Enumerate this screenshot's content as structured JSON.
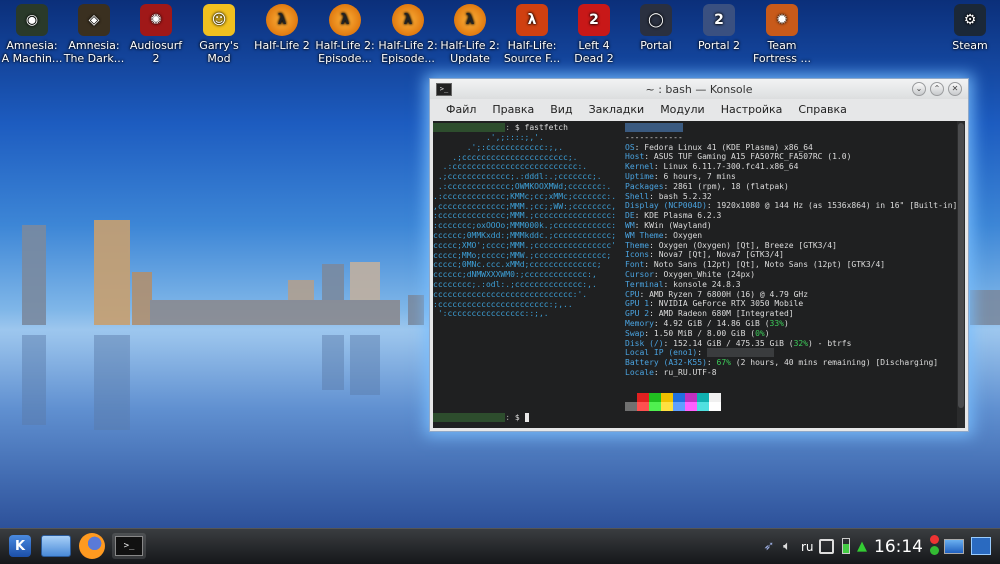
{
  "desktop": {
    "icons": [
      {
        "id": "amnesia-machine",
        "line1": "Amnesia:",
        "line2": "A Machin...",
        "glyph": "◉",
        "color": "#2a3a2a"
      },
      {
        "id": "amnesia-dark",
        "line1": "Amnesia:",
        "line2": "The Dark...",
        "glyph": "◈",
        "color": "#3a3020"
      },
      {
        "id": "audiosurf",
        "line1": "Audiosurf",
        "line2": "2",
        "glyph": "✺",
        "color": "#a01818"
      },
      {
        "id": "garrys-mod",
        "line1": "Garry's",
        "line2": "Mod",
        "glyph": "☺",
        "color": "#f0c020"
      },
      {
        "id": "half-life-2",
        "line1": "Half-Life 2",
        "line2": "",
        "glyph": "λ",
        "color": "hl2"
      },
      {
        "id": "hl2-ep1",
        "line1": "Half-Life 2:",
        "line2": "Episode...",
        "glyph": "λ",
        "color": "hl2"
      },
      {
        "id": "hl2-ep2",
        "line1": "Half-Life 2:",
        "line2": "Episode...",
        "glyph": "λ",
        "color": "hl2"
      },
      {
        "id": "hl2-update",
        "line1": "Half-Life 2:",
        "line2": "Update",
        "glyph": "λ",
        "color": "hl2"
      },
      {
        "id": "hl-source",
        "line1": "Half-Life:",
        "line2": "Source F...",
        "glyph": "λ",
        "color": "#d04010"
      },
      {
        "id": "l4d2",
        "line1": "Left 4",
        "line2": "Dead 2",
        "glyph": "2",
        "color": "#c81818"
      },
      {
        "id": "portal",
        "line1": "Portal",
        "line2": "",
        "glyph": "◯",
        "color": "#2a3040"
      },
      {
        "id": "portal-2",
        "line1": "Portal 2",
        "line2": "",
        "glyph": "2",
        "color": "#3a5080"
      },
      {
        "id": "tf2",
        "line1": "Team",
        "line2": "Fortress ...",
        "glyph": "✹",
        "color": "#c85a1a"
      },
      {
        "id": "steam",
        "line1": "Steam",
        "line2": "",
        "glyph": "⚙",
        "color": "#1b2838"
      }
    ]
  },
  "konsole": {
    "title": "~ : bash — Konsole",
    "menu": [
      "Файл",
      "Правка",
      "Вид",
      "Закладки",
      "Модули",
      "Настройка",
      "Справка"
    ],
    "command": "$ fastfetch",
    "logo": [
      "           .',;::::;,'.",
      "       .';:cccccccccccc:;,.",
      "    .;cccccccccccccccccccccc;.",
      "  .:cccccccccccccccccccccccccc:.",
      " .;ccccccccccccc;.:dddl:.;ccccccc;.",
      " .:ccccccccccccc;OWMKOOXMWd;ccccccc:.",
      ".:ccccccccccccc;KMMc;cc;xMMc;ccccccc:.",
      ",cccccccccccccc;MMM.;cc;;WW:;cccccccc,",
      ":cccccccccccccc;MMM.;cccccccccccccccc:",
      ":ccccccc;oxOOOo;MMM000k.;cccccccccccc:",
      "cccccc;0MMKxdd:;MMMkddc.;cccccccccccc;",
      "ccccc;XMO';cccc;MMM.;cccccccccccccccc'",
      "ccccc;MMo;ccccc;MMW.;ccccccccccccccc;",
      "ccccc;0MNc.ccc.xMMd;cccccccccccccc;",
      "cccccc;dNMWXXXWM0:;ccccccccccccc:,",
      "cccccccc;.:odl:.;cccccccccccccc:,.",
      "ccccccccccccccccccccccccccccc:'.",
      ":ccccccccccccccccccccccc:;,..",
      " ':cccccccccccccccc::;,."
    ],
    "info": [
      {
        "k": "",
        "v": "------------"
      },
      {
        "k": "OS",
        "v": "Fedora Linux 41 (KDE Plasma) x86_64"
      },
      {
        "k": "Host",
        "v": "ASUS TUF Gaming A15 FA507RC_FA507RC (1.0)"
      },
      {
        "k": "Kernel",
        "v": "Linux 6.11.7-300.fc41.x86_64"
      },
      {
        "k": "Uptime",
        "v": "6 hours, 7 mins"
      },
      {
        "k": "Packages",
        "v": "2861 (rpm), 18 (flatpak)"
      },
      {
        "k": "Shell",
        "v": "bash 5.2.32"
      },
      {
        "k": "Display (NCP004D)",
        "v": "1920x1080 @ 144 Hz (as 1536x864) in 16\" [Built-in]"
      },
      {
        "k": "DE",
        "v": "KDE Plasma 6.2.3"
      },
      {
        "k": "WM",
        "v": "KWin (Wayland)"
      },
      {
        "k": "WM Theme",
        "v": "Oxygen"
      },
      {
        "k": "Theme",
        "v": "Oxygen (Oxygen) [Qt], Breeze [GTK3/4]"
      },
      {
        "k": "Icons",
        "v": "Nova7 [Qt], Nova7 [GTK3/4]"
      },
      {
        "k": "Font",
        "v": "Noto Sans (12pt) [Qt], Noto Sans (12pt) [GTK3/4]"
      },
      {
        "k": "Cursor",
        "v": "Oxygen_White (24px)"
      },
      {
        "k": "Terminal",
        "v": "konsole 24.8.3"
      },
      {
        "k": "CPU",
        "v": "AMD Ryzen 7 6800H (16) @ 4.79 GHz"
      },
      {
        "k": "GPU 1",
        "v": "NVIDIA GeForce RTX 3050 Mobile"
      },
      {
        "k": "GPU 2",
        "v": "AMD Radeon 680M [Integrated]"
      },
      {
        "k": "Memory",
        "v": "4.92 GiB / 14.86 GiB (",
        "pct": "33%",
        "tail": ")"
      },
      {
        "k": "Swap",
        "v": "1.50 MiB / 8.00 GiB (",
        "pct": "0%",
        "tail": ")"
      },
      {
        "k": "Disk (/)",
        "v": "152.14 GiB / 475.35 GiB (",
        "pct": "32%",
        "tail": ") - btrfs"
      },
      {
        "k": "Local IP (eno1)",
        "v": ""
      },
      {
        "k": "Battery (A32-K55)",
        "v": "",
        "pct": "67%",
        "tail": " (2 hours, 40 mins remaining) [Discharging]"
      },
      {
        "k": "Locale",
        "v": "ru_RU.UTF-8"
      }
    ],
    "palette": {
      "row1": [
        "#1f2021",
        "#e02020",
        "#20c020",
        "#f0c000",
        "#2070e0",
        "#c030c0",
        "#10b0b0",
        "#f0f0f0"
      ],
      "row2": [
        "#707070",
        "#ff5050",
        "#50f050",
        "#ffe040",
        "#60a0ff",
        "#ff60ff",
        "#50e0e0",
        "#ffffff"
      ]
    },
    "prompt_end": "$"
  },
  "taskbar": {
    "lang": "ru",
    "clock": "16:14"
  }
}
